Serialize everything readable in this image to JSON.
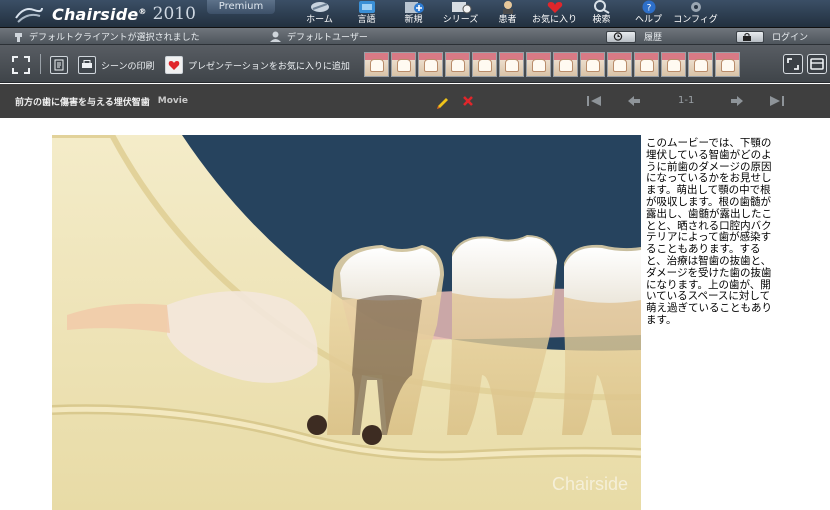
{
  "app": {
    "brand": "Chairside",
    "brand_mark": "®",
    "year": "2010",
    "edition": "Premium"
  },
  "nav": [
    {
      "label": "ホーム",
      "icon": "home-icon"
    },
    {
      "label": "言語",
      "icon": "language-icon"
    },
    {
      "label": "新規",
      "icon": "new-icon"
    },
    {
      "label": "シリーズ",
      "icon": "series-icon"
    },
    {
      "label": "患者",
      "icon": "patient-icon"
    },
    {
      "label": "お気に入り",
      "icon": "favorites-icon"
    },
    {
      "label": "検索",
      "icon": "search-icon"
    },
    {
      "label": "ヘルプ",
      "icon": "help-icon"
    },
    {
      "label": "コンフィグ",
      "icon": "config-icon"
    }
  ],
  "status": {
    "client": "デフォルトクライアントが選択されました",
    "user": "デフォルトユーザー",
    "history": "履歴",
    "login": "ログイン"
  },
  "toolbar": {
    "print_label": "シーンの印刷",
    "favorite_label": "プレゼンテーションをお気に入りに追加"
  },
  "title": {
    "text": "前方の歯に傷害を与える埋伏智歯",
    "type": "Movie"
  },
  "pager": {
    "position": "1-1"
  },
  "content": {
    "description": "このムービーでは、下顎の埋伏している智歯がどのように前歯のダメージの原因になっているかをお見せします。萌出して顎の中で根が吸収します。根の歯髄が露出し、歯髄が露出したことと、晒される口腔内バクテリアによって歯が感染することもあります。すると、治療は智歯の抜歯と、ダメージを受けた歯の抜歯になります。上の歯が、開いているスペースに対して萌え過ぎていることもあります。",
    "watermark": "Chairside"
  },
  "colors": {
    "nav_bg": "#2d3d50",
    "title_bg": "#3f3f3f",
    "accent_red": "#e0262b",
    "accent_yellow": "#f0c419"
  }
}
